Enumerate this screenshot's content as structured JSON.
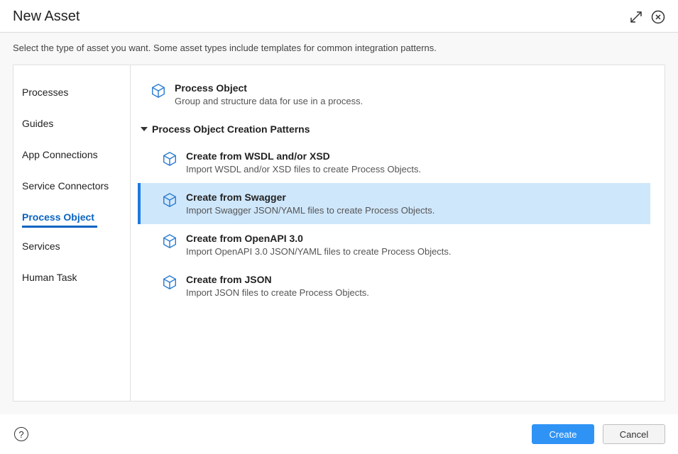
{
  "dialog": {
    "title": "New Asset",
    "subtitle": "Select the type of asset you want. Some asset types include templates for common integration patterns."
  },
  "sidebar": {
    "items": [
      {
        "label": "Processes",
        "active": false
      },
      {
        "label": "Guides",
        "active": false
      },
      {
        "label": "App Connections",
        "active": false
      },
      {
        "label": "Service Connectors",
        "active": false
      },
      {
        "label": "Process Object",
        "active": true
      },
      {
        "label": "Services",
        "active": false
      },
      {
        "label": "Human Task",
        "active": false
      }
    ]
  },
  "main": {
    "primary": {
      "title": "Process Object",
      "desc": "Group and structure data for use in a process."
    },
    "section_header": "Process Object Creation Patterns",
    "patterns": [
      {
        "title": "Create from WSDL and/or XSD",
        "desc": "Import WSDL and/or XSD files to create Process Objects.",
        "selected": false
      },
      {
        "title": "Create from Swagger",
        "desc": "Import Swagger JSON/YAML files to create Process Objects.",
        "selected": true
      },
      {
        "title": "Create from OpenAPI 3.0",
        "desc": "Import OpenAPI 3.0 JSON/YAML files to create Process Objects.",
        "selected": false
      },
      {
        "title": "Create from JSON",
        "desc": "Import JSON files to create Process Objects.",
        "selected": false
      }
    ]
  },
  "footer": {
    "create": "Create",
    "cancel": "Cancel"
  },
  "icons": {
    "cube_color": "#2f7fd1"
  }
}
